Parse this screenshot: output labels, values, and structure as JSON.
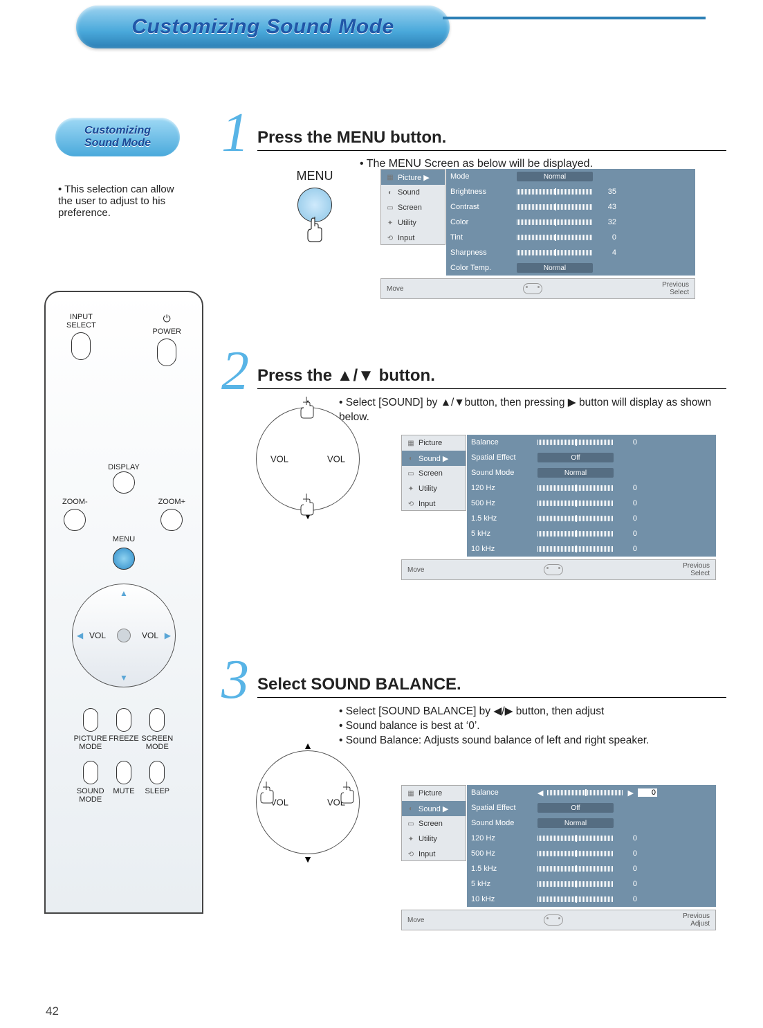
{
  "page_number": "42",
  "title": "Customizing Sound Mode",
  "chapter": {
    "line1": "Customizing",
    "line2": "Sound Mode"
  },
  "chapter_desc": "This selection can allow the user to adjust to his preference.",
  "remote": {
    "input_select": "INPUT\nSELECT",
    "power": "POWER",
    "display": "DISPLAY",
    "zoom_minus": "ZOOM-",
    "zoom_plus": "ZOOM+",
    "menu": "MENU",
    "vol": "VOL",
    "picture_mode": "PICTURE\nMODE",
    "freeze": "FREEZE",
    "screen_mode": "SCREEN\nMODE",
    "sound_mode": "SOUND\nMODE",
    "mute": "MUTE",
    "sleep": "SLEEP"
  },
  "steps": {
    "s1": {
      "num": "1",
      "title": "Press the MENU button.",
      "desc": "The MENU Screen as below will be displayed.",
      "menu_label": "MENU"
    },
    "s2": {
      "num": "2",
      "title": "Press the ▲/▼ button.",
      "desc": "Select [SOUND] by  ▲/▼button, then pressing ▶ button will display as shown below."
    },
    "s3": {
      "num": "3",
      "title": "Select SOUND BALANCE.",
      "desc1": "Select [SOUND BALANCE] by ◀/▶ button, then adjust",
      "desc2": "Sound balance is best at ‘0’.",
      "desc3": "Sound Balance: Adjusts sound balance of left and right speaker."
    }
  },
  "osd_common": {
    "side_items": [
      "Picture",
      "Sound",
      "Screen",
      "Utility",
      "Input"
    ],
    "footer_move": "Move",
    "footer_prev": "Previous",
    "footer_select": "Select",
    "footer_adjust": "Adjust"
  },
  "osd1": {
    "active": "Picture",
    "rows": [
      {
        "lbl": "Mode",
        "type": "pill",
        "val": "Normal"
      },
      {
        "lbl": "Brightness",
        "type": "bar",
        "val": "35"
      },
      {
        "lbl": "Contrast",
        "type": "bar",
        "val": "43"
      },
      {
        "lbl": "Color",
        "type": "bar",
        "val": "32"
      },
      {
        "lbl": "Tint",
        "type": "bar",
        "val": "0"
      },
      {
        "lbl": "Sharpness",
        "type": "bar",
        "val": "4"
      },
      {
        "lbl": "Color Temp.",
        "type": "pill",
        "val": "Normal"
      }
    ]
  },
  "osd2": {
    "active": "Sound",
    "rows": [
      {
        "lbl": "Balance",
        "type": "bar",
        "val": "0"
      },
      {
        "lbl": "Spatial Effect",
        "type": "pill",
        "val": "Off"
      },
      {
        "lbl": "Sound Mode",
        "type": "pill",
        "val": "Normal"
      },
      {
        "lbl": "120 Hz",
        "type": "bar",
        "val": "0"
      },
      {
        "lbl": "500 Hz",
        "type": "bar",
        "val": "0"
      },
      {
        "lbl": "1.5 kHz",
        "type": "bar",
        "val": "0"
      },
      {
        "lbl": "5    kHz",
        "type": "bar",
        "val": "0"
      },
      {
        "lbl": "10  kHz",
        "type": "bar",
        "val": "0"
      }
    ]
  },
  "osd3": {
    "active": "Sound",
    "selected_row": "Balance",
    "rows": [
      {
        "lbl": "Balance",
        "type": "bar_sel",
        "val": "0"
      },
      {
        "lbl": "Spatial Effect",
        "type": "pill",
        "val": "Off"
      },
      {
        "lbl": "Sound Mode",
        "type": "pill",
        "val": "Normal"
      },
      {
        "lbl": "120 Hz",
        "type": "bar",
        "val": "0"
      },
      {
        "lbl": "500 Hz",
        "type": "bar",
        "val": "0"
      },
      {
        "lbl": "1.5 kHz",
        "type": "bar",
        "val": "0"
      },
      {
        "lbl": "5    kHz",
        "type": "bar",
        "val": "0"
      },
      {
        "lbl": "10  kHz",
        "type": "bar",
        "val": "0"
      }
    ]
  }
}
